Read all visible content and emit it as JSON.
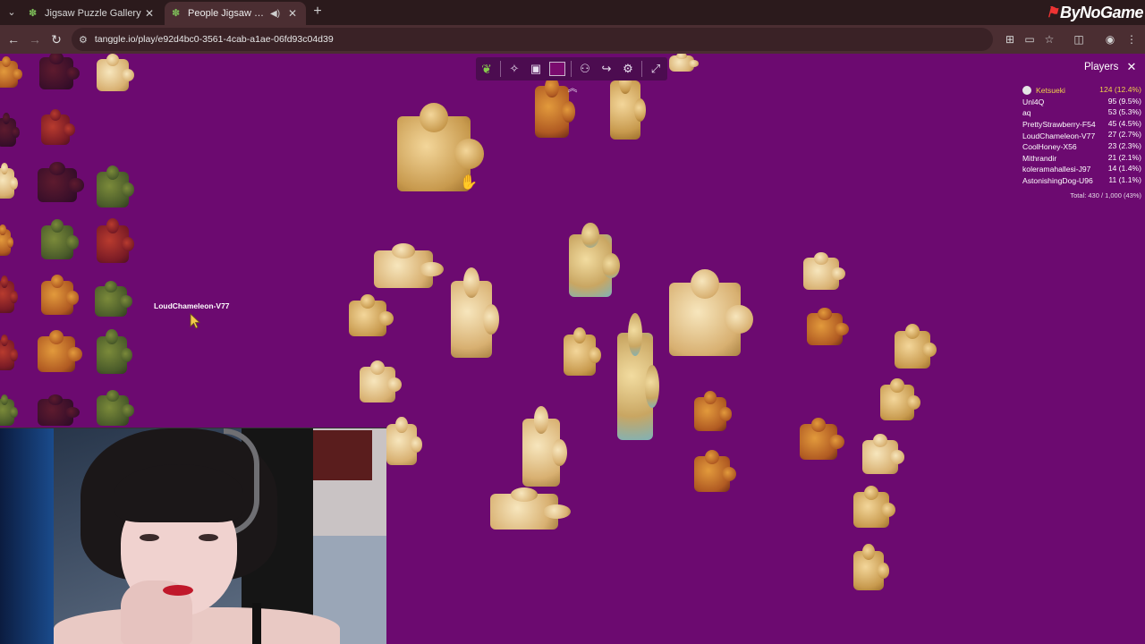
{
  "browser": {
    "tabs": [
      {
        "label": "Jigsaw Puzzle Gallery",
        "active": false
      },
      {
        "label": "People Jigsaw Puzzle",
        "active": true
      }
    ],
    "new_tab": "+",
    "url": "tanggle.io/play/e92d4bc0-3561-4cab-a1ae-06fd93c04d39",
    "brand": "ByNoGame"
  },
  "puzzle_toolbar": {
    "icons": [
      "leaf-logo-icon",
      "pieces-icon",
      "preview-image-icon",
      "background-color-icon",
      "players-icon",
      "share-icon",
      "settings-icon",
      "fullscreen-icon"
    ],
    "background_color": "#7a0b6e"
  },
  "players_panel": {
    "title": "Players",
    "players": [
      {
        "name": "Ketsueki",
        "score": "124 (12.4%)",
        "me": true
      },
      {
        "name": "Unl4Q",
        "score": "95 (9.5%)",
        "me": false
      },
      {
        "name": "aq",
        "score": "53 (5.3%)",
        "me": false
      },
      {
        "name": "PrettyStrawberry-F54",
        "score": "45 (4.5%)",
        "me": false
      },
      {
        "name": "LoudChameleon-V77",
        "score": "27 (2.7%)",
        "me": false
      },
      {
        "name": "CoolHoney-X56",
        "score": "23 (2.3%)",
        "me": false
      },
      {
        "name": "Mithrandir",
        "score": "21 (2.1%)",
        "me": false
      },
      {
        "name": "koleramahallesi-J97",
        "score": "14 (1.4%)",
        "me": false
      },
      {
        "name": "AstonishingDog-U96",
        "score": "11 (1.1%)",
        "me": false
      }
    ],
    "total": "Total: 430 / 1,000 (43%)"
  },
  "cursor_label": "LoudChameleon-V77",
  "colors": {
    "board": "#6c0a70",
    "chrome": "#2b1a1c",
    "toolbar": "#4b2e32",
    "highlight": "#f0d24a"
  }
}
